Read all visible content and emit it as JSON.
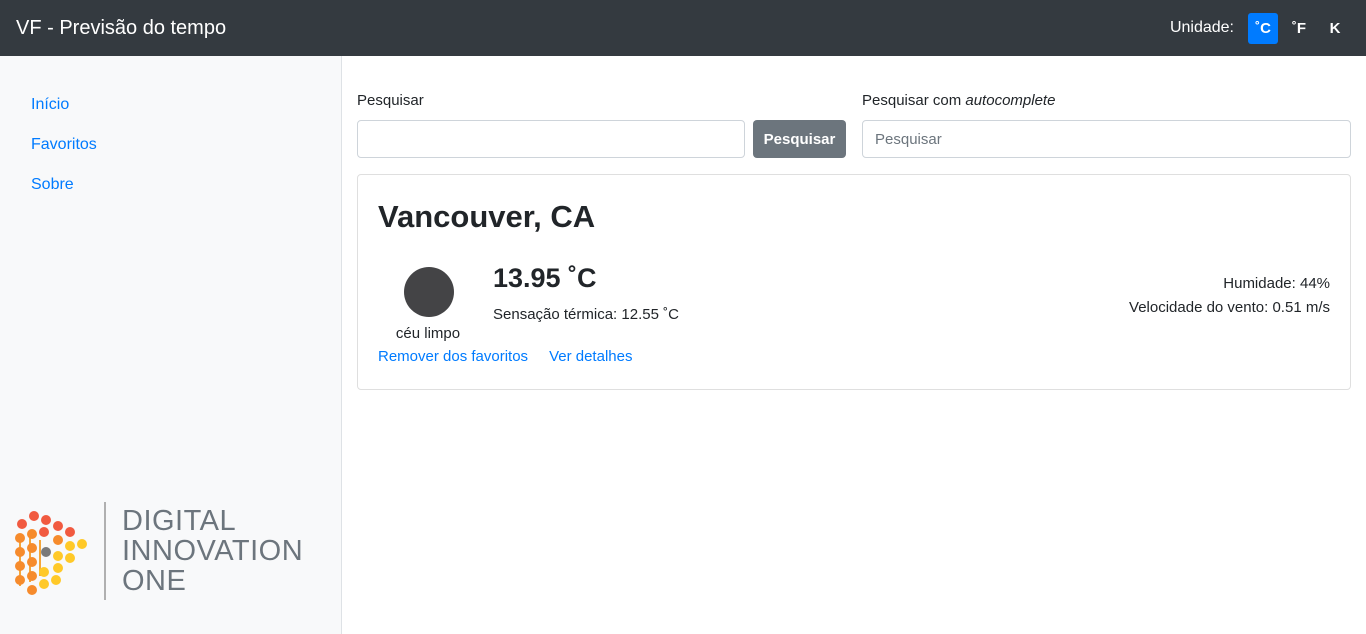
{
  "navbar": {
    "brand": "VF - Previsão do tempo",
    "unit_label": "Unidade:",
    "units": [
      "˚C",
      "˚F",
      "K"
    ],
    "active_unit": "˚C",
    "active_color": "#007bff"
  },
  "sidebar": {
    "items": [
      {
        "label": "Início"
      },
      {
        "label": "Favoritos"
      },
      {
        "label": "Sobre"
      }
    ],
    "logo": {
      "lines": [
        "DIGITAL",
        "INNOVATION",
        "ONE"
      ]
    }
  },
  "search": {
    "label": "Pesquisar",
    "value": "",
    "button_label": "Pesquisar",
    "autocomplete_label_prefix": "Pesquisar com ",
    "autocomplete_label_em": "autocomplete",
    "autocomplete_placeholder": "Pesquisar"
  },
  "card": {
    "city": "Vancouver, CA",
    "icon": "weather-icon",
    "description": "céu limpo",
    "temperature": "13.95 ˚C",
    "feels_like": "Sensação térmica: 12.55 ˚C",
    "humidity": "Humidade: 44%",
    "wind": "Velocidade do vento: 0.51 m/s",
    "remove_link": "Remover dos favoritos",
    "details_link": "Ver detalhes"
  }
}
